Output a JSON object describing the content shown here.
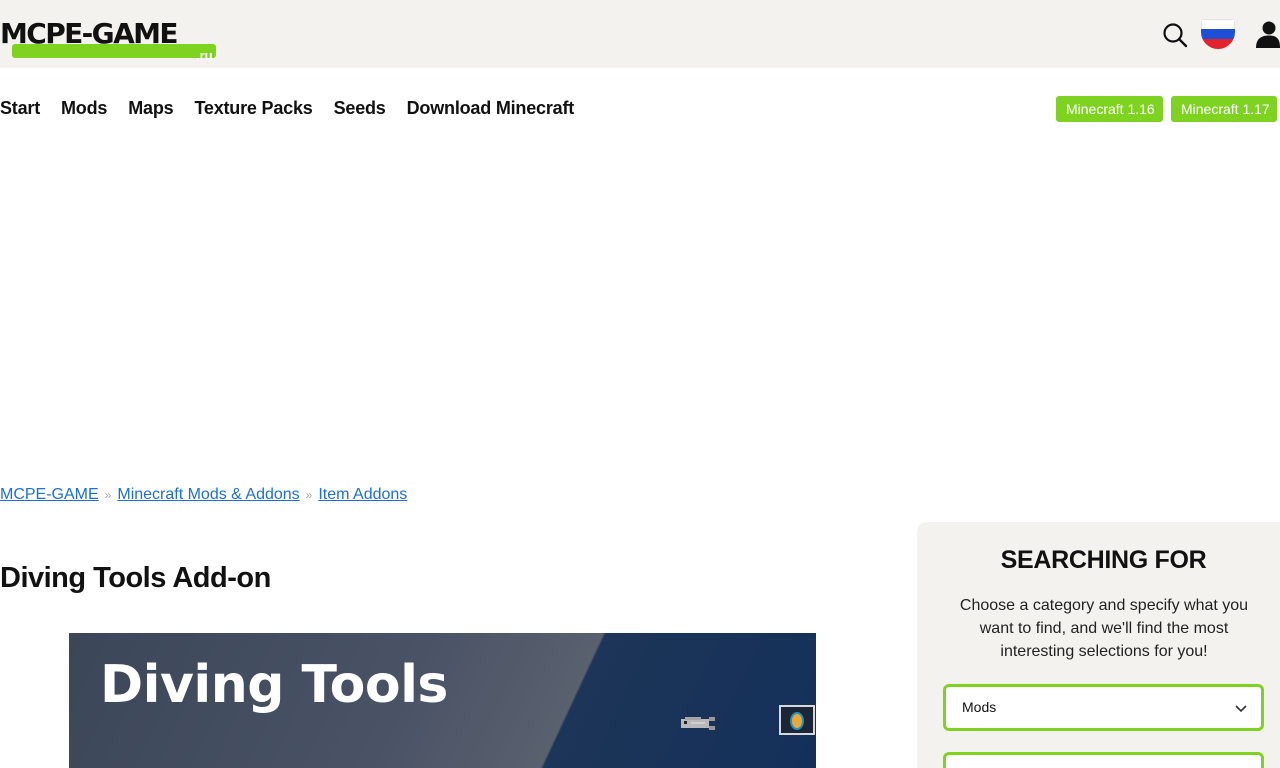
{
  "header": {
    "logo_text": "MCPE-GAME",
    "logo_tld": ".ru"
  },
  "icons": {
    "search": "search-icon",
    "language": "russia-flag-icon",
    "user": "user-icon"
  },
  "nav": {
    "items": [
      "Start",
      "Mods",
      "Maps",
      "Texture Packs",
      "Seeds",
      "Download Minecraft"
    ]
  },
  "versions": [
    "Minecraft 1.16",
    "Minecraft 1.17"
  ],
  "breadcrumb": {
    "items": [
      "MCPE-GAME",
      "Minecraft Mods & Addons",
      "Item Addons"
    ],
    "separator": "»"
  },
  "page": {
    "title": "Diving Tools Add-on"
  },
  "hero": {
    "title": "Diving Tools"
  },
  "sidebar": {
    "heading": "SEARCHING FOR",
    "description": "Choose a category and specify what you want to find, and we'll find the most interesting selections for you!",
    "category_select": "Mods"
  },
  "colors": {
    "accent": "#7ed321",
    "header_bg": "#f3f2ee",
    "link": "#1a6fdb"
  }
}
